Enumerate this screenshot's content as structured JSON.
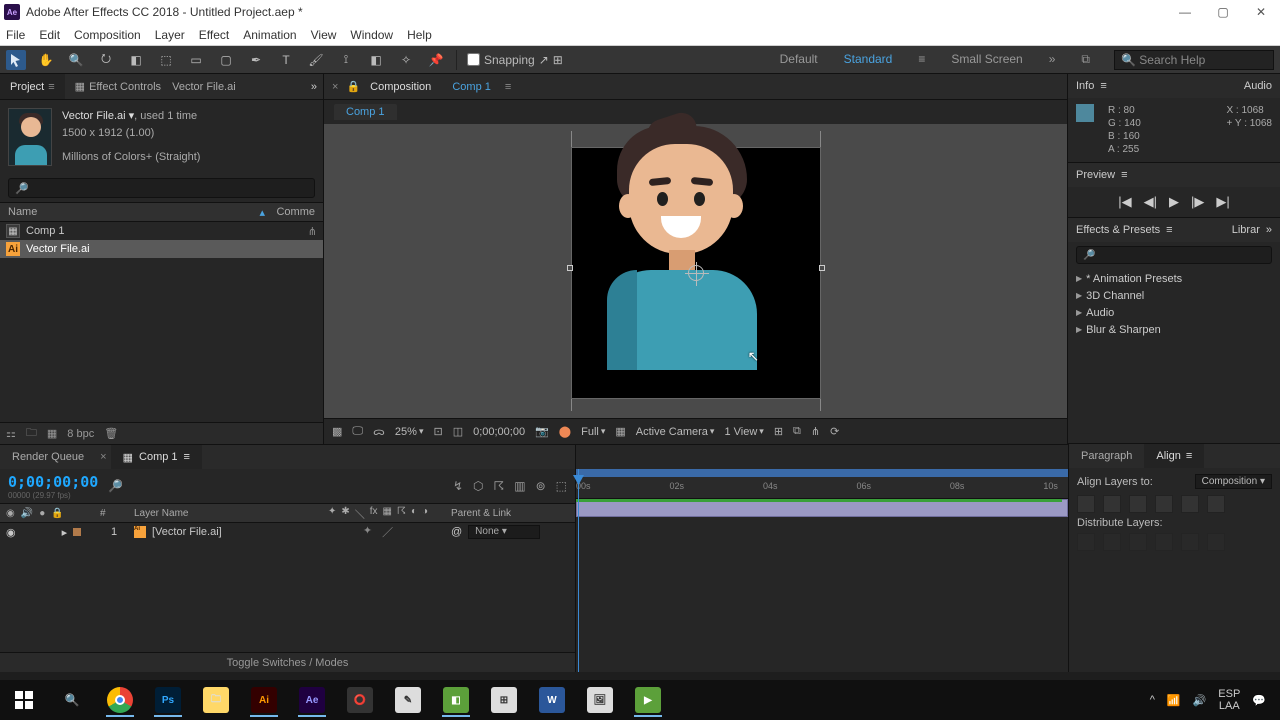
{
  "titlebar": {
    "app": "Adobe After Effects CC 2018",
    "doc": "Untitled Project.aep *"
  },
  "menu": [
    "File",
    "Edit",
    "Composition",
    "Layer",
    "Effect",
    "Animation",
    "View",
    "Window",
    "Help"
  ],
  "toolrow": {
    "snapping": "Snapping",
    "workspaces": {
      "default": "Default",
      "standard": "Standard",
      "small": "Small Screen"
    },
    "search_placeholder": "Search Help"
  },
  "project": {
    "tab_project": "Project",
    "tab_effectcontrols": "Effect Controls",
    "tab_ec_item": "Vector File.ai",
    "head_name": "Vector File.ai ▾",
    "head_used": ", used 1 time",
    "head_dim": "1500 x 1912 (1.00)",
    "head_colors": "Millions of Colors+ (Straight)",
    "col_name": "Name",
    "col_comment": "Comme",
    "rows": [
      {
        "icon": "comp",
        "label": "Comp 1"
      },
      {
        "icon": "ai",
        "label": "Vector File.ai"
      }
    ],
    "bpc": "8 bpc"
  },
  "comp": {
    "panel_label": "Composition",
    "panel_item": "Comp 1",
    "tab": "Comp 1",
    "footer": {
      "zoom": "25%",
      "tc": "0;00;00;00",
      "res": "Full",
      "camera": "Active Camera",
      "view": "1 View"
    }
  },
  "info": {
    "title": "Info",
    "audio": "Audio",
    "r": "R : 80",
    "g": "G : 140",
    "b": "B : 160",
    "a": "A : 255",
    "x": "X : 1068",
    "y": "Y : 1068"
  },
  "preview": {
    "title": "Preview"
  },
  "effects": {
    "title": "Effects & Presets",
    "lib": "Librar",
    "items": [
      "* Animation Presets",
      "3D Channel",
      "Audio",
      "Blur & Sharpen"
    ]
  },
  "timeline": {
    "render_queue": "Render Queue",
    "comp_tab": "Comp 1",
    "timecode": "0;00;00;00",
    "sub": "00000 (29.97 fps)",
    "col_num": "#",
    "col_layer": "Layer Name",
    "col_parent": "Parent & Link",
    "layer_num": "1",
    "layer_name": "[Vector File.ai]",
    "parent_none": "None",
    "marks": [
      "00s",
      "02s",
      "04s",
      "06s",
      "08s",
      "10s"
    ],
    "toggle": "Toggle Switches / Modes"
  },
  "align": {
    "paragraph": "Paragraph",
    "align": "Align",
    "label": "Align Layers to:",
    "target": "Composition",
    "dist": "Distribute Layers:"
  },
  "tray": {
    "lang1": "ESP",
    "lang2": "LAA"
  }
}
